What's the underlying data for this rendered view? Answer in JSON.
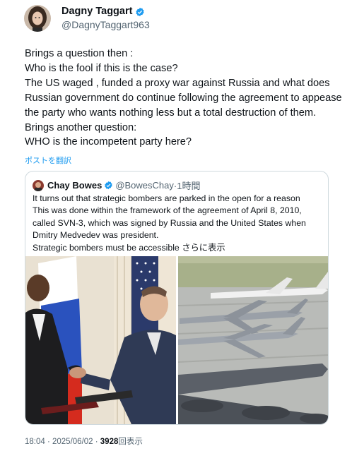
{
  "author": {
    "display_name": "Dagny Taggart",
    "handle": "@DagnyTaggart963"
  },
  "tweet": {
    "lines": [
      "Brings a question then :",
      "Who is the fool if this is the case?",
      "The US waged , funded a proxy war against Russia and what does",
      "Russian government do continue following the agreement to appease",
      "the party who wants nothing less but a total destruction of them.",
      "Brings another question:",
      "WHO is the incompetent party here?"
    ],
    "translate_label": "ポストを翻訳"
  },
  "quote": {
    "display_name": "Chay Bowes",
    "handle": "@BowesChay",
    "time": "·1時間",
    "lines": [
      "It turns out that strategic bombers are parked in the open for a reason",
      "This was done within the framework of the agreement of April 8, 2010,",
      "called SVN-3, which was signed by Russia and the United States when",
      "Dmitry Medvedev was president.",
      "Strategic bombers must be accessible"
    ],
    "more_label": "さらに表示"
  },
  "footer": {
    "timestamp": "18:04 · 2025/06/02 · ",
    "views_count": "3928",
    "views_label": "回表示"
  },
  "colors": {
    "verified": "#1d9bf0",
    "link": "#1d9bf0",
    "border": "#cfd9de",
    "secondary_text": "#536471"
  },
  "icons": {
    "verified": "verified-badge-icon"
  }
}
